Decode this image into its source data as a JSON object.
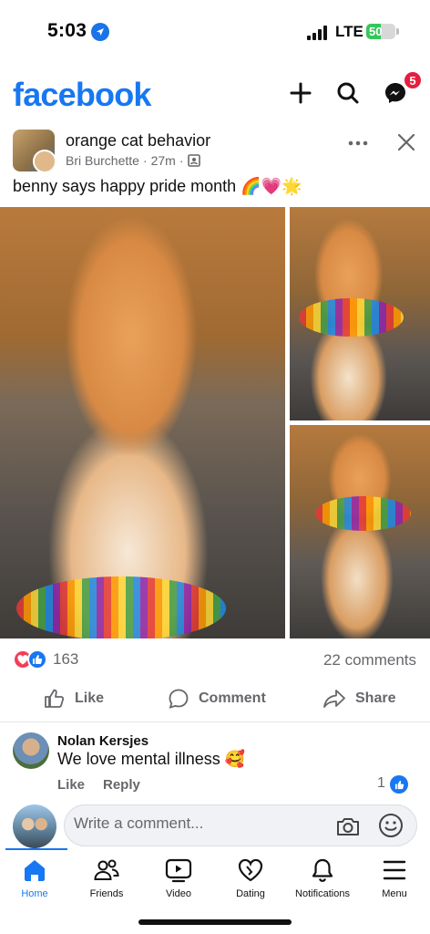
{
  "status_bar": {
    "time": "5:03",
    "network": "LTE",
    "battery": "50",
    "battery_level": 0.5
  },
  "header": {
    "logo": "facebook",
    "messenger_badge": "5"
  },
  "post": {
    "group_name": "orange cat behavior",
    "author": "Bri Burchette",
    "time": "27m",
    "dot": "·",
    "text": "benny says happy pride month 🌈💗🌟",
    "reaction_count": "163",
    "comments_count": "22 comments"
  },
  "actions": {
    "like": "Like",
    "comment": "Comment",
    "share": "Share"
  },
  "comment": {
    "author": "Nolan Kersjes",
    "text": "We love mental illness 🥰",
    "like_label": "Like",
    "reply_label": "Reply",
    "reactions": "1"
  },
  "composer": {
    "placeholder": "Write a comment..."
  },
  "bottom_nav": {
    "items": [
      {
        "label": "Home",
        "icon": "home-icon"
      },
      {
        "label": "Friends",
        "icon": "friends-icon"
      },
      {
        "label": "Video",
        "icon": "video-icon"
      },
      {
        "label": "Dating",
        "icon": "dating-icon"
      },
      {
        "label": "Notifications",
        "icon": "bell-icon"
      },
      {
        "label": "Menu",
        "icon": "menu-icon"
      }
    ]
  },
  "colors": {
    "brand": "#1877f2",
    "badge": "#e41e3f",
    "love": "#f33e58",
    "battery": "#34c759"
  }
}
